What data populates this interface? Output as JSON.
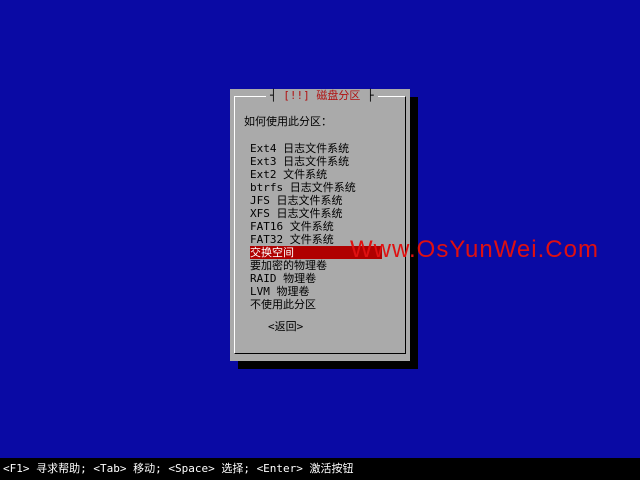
{
  "dialog": {
    "title_prefix": "[!!]",
    "title": "磁盘分区",
    "prompt": "如何使用此分区：",
    "options": [
      {
        "label": "Ext4 日志文件系统"
      },
      {
        "label": "Ext3 日志文件系统"
      },
      {
        "label": "Ext2 文件系统"
      },
      {
        "label": "btrfs 日志文件系统"
      },
      {
        "label": "JFS 日志文件系统"
      },
      {
        "label": "XFS 日志文件系统"
      },
      {
        "label": "FAT16 文件系统"
      },
      {
        "label": "FAT32 文件系统"
      },
      {
        "label": "交换空间"
      },
      {
        "label": "要加密的物理卷"
      },
      {
        "label": "RAID 物理卷"
      },
      {
        "label": "LVM 物理卷"
      },
      {
        "label": "不使用此分区"
      }
    ],
    "selected_option": "交换空间",
    "back_label": "<返回>"
  },
  "watermark": "Www.OsYunWei.Com",
  "status_bar": {
    "text": "<F1> 寻求帮助; <Tab> 移动; <Space> 选择; <Enter> 激活按钮"
  },
  "colors": {
    "background": "#0a0aa4",
    "dialog": "#aaaaaa",
    "title": "#b01010",
    "highlight": "#b00000",
    "watermark": "#e01010",
    "status_bar": "#000000"
  }
}
